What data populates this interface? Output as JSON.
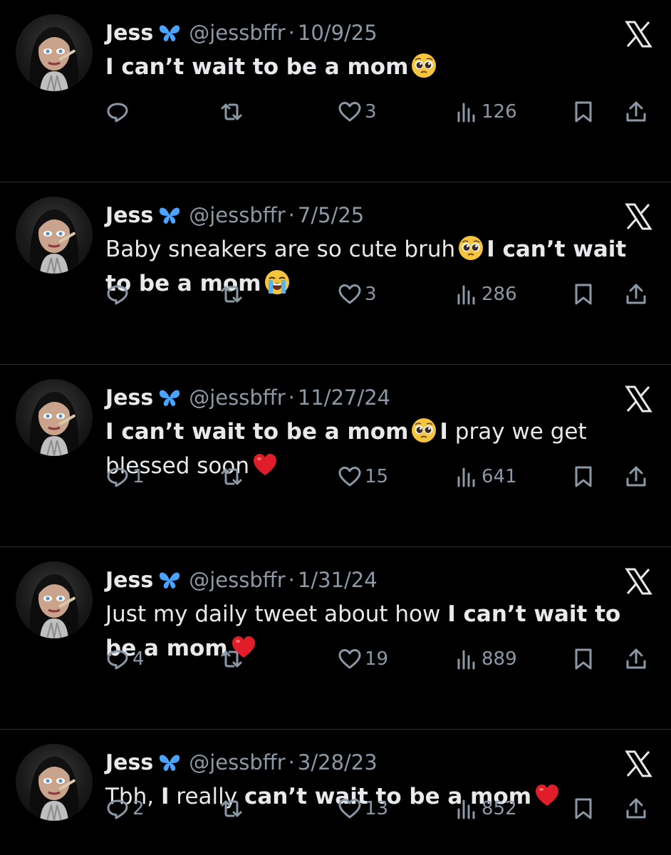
{
  "tweets": [
    {
      "name": "Jess",
      "handle": "@jessbffr",
      "separator": "·",
      "date": "10/9/25",
      "segments": [
        {
          "text": "I can’t wait to be a mom",
          "bold": true
        },
        {
          "emoji": "pleading-face-emoji"
        }
      ],
      "replies": "",
      "likes": "3",
      "views": "126"
    },
    {
      "name": "Jess",
      "handle": "@jessbffr",
      "separator": "·",
      "date": "7/5/25",
      "segments": [
        {
          "text": "Baby sneakers are so cute bruh",
          "bold": false
        },
        {
          "emoji": "pleading-face-emoji"
        },
        {
          "text": "I can’t wait to be a mom",
          "bold": true
        },
        {
          "emoji": "loudly-crying-face-emoji"
        }
      ],
      "replies": "",
      "likes": "3",
      "views": "286"
    },
    {
      "name": "Jess",
      "handle": "@jessbffr",
      "separator": "·",
      "date": "11/27/24",
      "segments": [
        {
          "text": "I can’t wait to be a mom",
          "bold": true
        },
        {
          "emoji": "pleading-face-emoji"
        },
        {
          "text": "I",
          "bold": true
        },
        {
          "text": " pray we get blessed soon",
          "bold": false
        },
        {
          "emoji": "red-heart-emoji"
        }
      ],
      "replies": "1",
      "likes": "15",
      "views": "641"
    },
    {
      "name": "Jess",
      "handle": "@jessbffr",
      "separator": "·",
      "date": "1/31/24",
      "segments": [
        {
          "text": "Just my daily tweet about how ",
          "bold": false
        },
        {
          "text": "I can’t wait to be a mom",
          "bold": true
        },
        {
          "emoji": "red-heart-emoji"
        }
      ],
      "replies": "4",
      "likes": "19",
      "views": "889"
    },
    {
      "name": "Jess",
      "handle": "@jessbffr",
      "separator": "·",
      "date": "3/28/23",
      "segments": [
        {
          "text": "Tbh, ",
          "bold": false
        },
        {
          "text": "I",
          "bold": true
        },
        {
          "text": " really ",
          "bold": false
        },
        {
          "text": "can’t wait to be a mom",
          "bold": true
        },
        {
          "emoji": "red-heart-emoji"
        }
      ],
      "replies": "2",
      "likes": "13",
      "views": "852"
    }
  ],
  "colors": {
    "background": "#000000",
    "text": "#e7e9ea",
    "muted": "#8b98a5",
    "divider": "#2f3336",
    "butterfly": "#4aa3ff"
  }
}
